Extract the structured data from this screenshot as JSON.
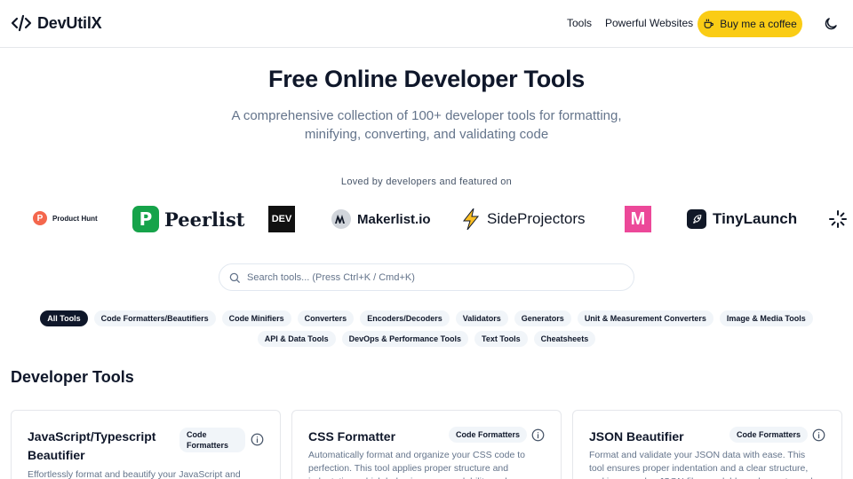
{
  "brand": {
    "name": "DevUtilX"
  },
  "nav": {
    "tools": "Tools",
    "powerful_websites": "Powerful Websites",
    "coffee": "Buy me a coffee"
  },
  "hero": {
    "title": "Free Online Developer Tools",
    "subtitle": "A comprehensive collection of 100+ developer tools for formatting, minifying, converting, and validating code",
    "loved": "Loved by developers and featured on"
  },
  "logos": {
    "producthunt": "Product Hunt",
    "peerlist": "Peerlist",
    "peerlist_mark": "P",
    "dev": "DEV",
    "makerlist": "Makerlist.io",
    "sideprojectors": "SideProjectors",
    "m_mark": "M",
    "tinylaunch": "TinyLaunch"
  },
  "search": {
    "placeholder": "Search tools... (Press Ctrl+K / Cmd+K)"
  },
  "categories": [
    "All Tools",
    "Code Formatters/Beautifiers",
    "Code Minifiers",
    "Converters",
    "Encoders/Decoders",
    "Validators",
    "Generators",
    "Unit & Measurement Converters",
    "Image & Media Tools",
    "API & Data Tools",
    "DevOps & Performance Tools",
    "Text Tools",
    "Cheatsheets"
  ],
  "section": {
    "title": "Developer Tools"
  },
  "cards": [
    {
      "title": "JavaScript/Typescript Beautifier",
      "badge": "Code Formatters",
      "desc": "Effortlessly format and beautify your JavaScript and"
    },
    {
      "title": "CSS Formatter",
      "badge": "Code Formatters",
      "desc": "Automatically format and organize your CSS code to perfection. This tool applies proper structure and indentation, which helps improve readability and"
    },
    {
      "title": "JSON Beautifier",
      "badge": "Code Formatters",
      "desc": "Format and validate your JSON data with ease. This tool ensures proper indentation and a clear structure, making complex JSON files readable and easy to work with"
    }
  ],
  "colors": {
    "accent_yellow": "#facc15",
    "chip_active": "#0f172a",
    "chip_bg": "#f1f5f9"
  }
}
